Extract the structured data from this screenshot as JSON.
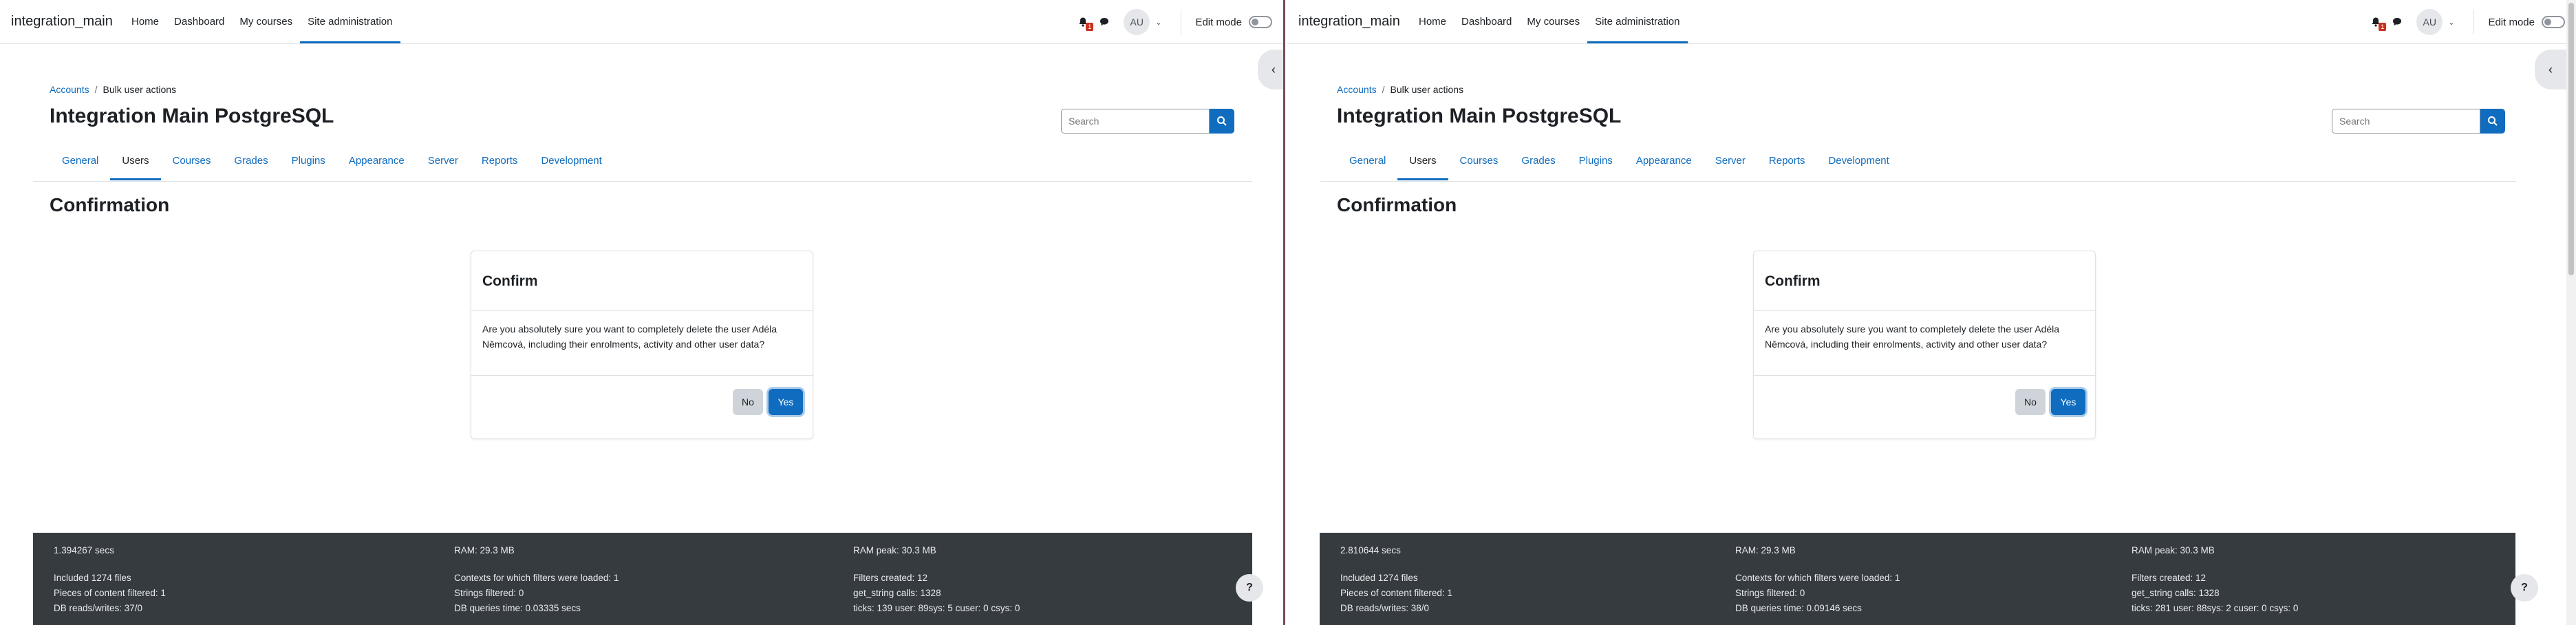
{
  "panes": [
    {
      "navbar": {
        "brand": "integration_main",
        "links": [
          "Home",
          "Dashboard",
          "My courses",
          "Site administration"
        ],
        "notification_count": "1",
        "avatar_initials": "AU",
        "edit_mode_label": "Edit mode"
      },
      "breadcrumb": {
        "parent": "Accounts",
        "current": "Bulk user actions"
      },
      "page_title": "Integration Main PostgreSQL",
      "search": {
        "placeholder": "Search"
      },
      "tabs": [
        "General",
        "Users",
        "Courses",
        "Grades",
        "Plugins",
        "Appearance",
        "Server",
        "Reports",
        "Development"
      ],
      "active_tab": "Users",
      "section_title": "Confirmation",
      "dialog": {
        "title": "Confirm",
        "message": "Are you absolutely sure you want to completely delete the user Adéla Němcová, including their enrolments, activity and other user data?",
        "no_label": "No",
        "yes_label": "Yes"
      },
      "footer": {
        "col1": [
          "1.394267 secs",
          "Included 1274 files",
          "Pieces of content filtered: 1",
          "DB reads/writes: 37/0"
        ],
        "col2": [
          "RAM: 29.3 MB",
          "Contexts for which filters were loaded: 1",
          "Strings filtered: 0",
          "DB queries time: 0.03335 secs"
        ],
        "col3": [
          "RAM peak: 30.3 MB",
          "Filters created: 12",
          "get_string calls: 1328",
          "ticks: 139 user: 89sys: 5 cuser: 0 csys: 0"
        ]
      },
      "help_label": "?"
    },
    {
      "navbar": {
        "brand": "integration_main",
        "links": [
          "Home",
          "Dashboard",
          "My courses",
          "Site administration"
        ],
        "notification_count": "1",
        "avatar_initials": "AU",
        "edit_mode_label": "Edit mode"
      },
      "breadcrumb": {
        "parent": "Accounts",
        "current": "Bulk user actions"
      },
      "page_title": "Integration Main PostgreSQL",
      "search": {
        "placeholder": "Search"
      },
      "tabs": [
        "General",
        "Users",
        "Courses",
        "Grades",
        "Plugins",
        "Appearance",
        "Server",
        "Reports",
        "Development"
      ],
      "active_tab": "Users",
      "section_title": "Confirmation",
      "dialog": {
        "title": "Confirm",
        "message": "Are you absolutely sure you want to completely delete the user Adéla Němcová, including their enrolments, activity and other user data?",
        "no_label": "No",
        "yes_label": "Yes"
      },
      "footer": {
        "col1": [
          "2.810644 secs",
          "Included 1274 files",
          "Pieces of content filtered: 1",
          "DB reads/writes: 38/0"
        ],
        "col2": [
          "RAM: 29.3 MB",
          "Contexts for which filters were loaded: 1",
          "Strings filtered: 0",
          "DB queries time: 0.09146 secs"
        ],
        "col3": [
          "RAM peak: 30.3 MB",
          "Filters created: 12",
          "get_string calls: 1328",
          "ticks: 281 user: 88sys: 2 cuser: 0 csys: 0"
        ]
      },
      "help_label": "?"
    }
  ],
  "icons": {
    "notifications": "bell-icon",
    "messages": "chat-bubble-icon",
    "user_menu": "chevron-down-icon",
    "search": "magnifier-icon",
    "drawer": "chevron-left-icon",
    "help": "question-icon"
  },
  "colors": {
    "primary": "#0f6cbf",
    "footer_bg": "#363b40",
    "badge": "#ca3120",
    "pane_divider": "#7a4b5a"
  }
}
